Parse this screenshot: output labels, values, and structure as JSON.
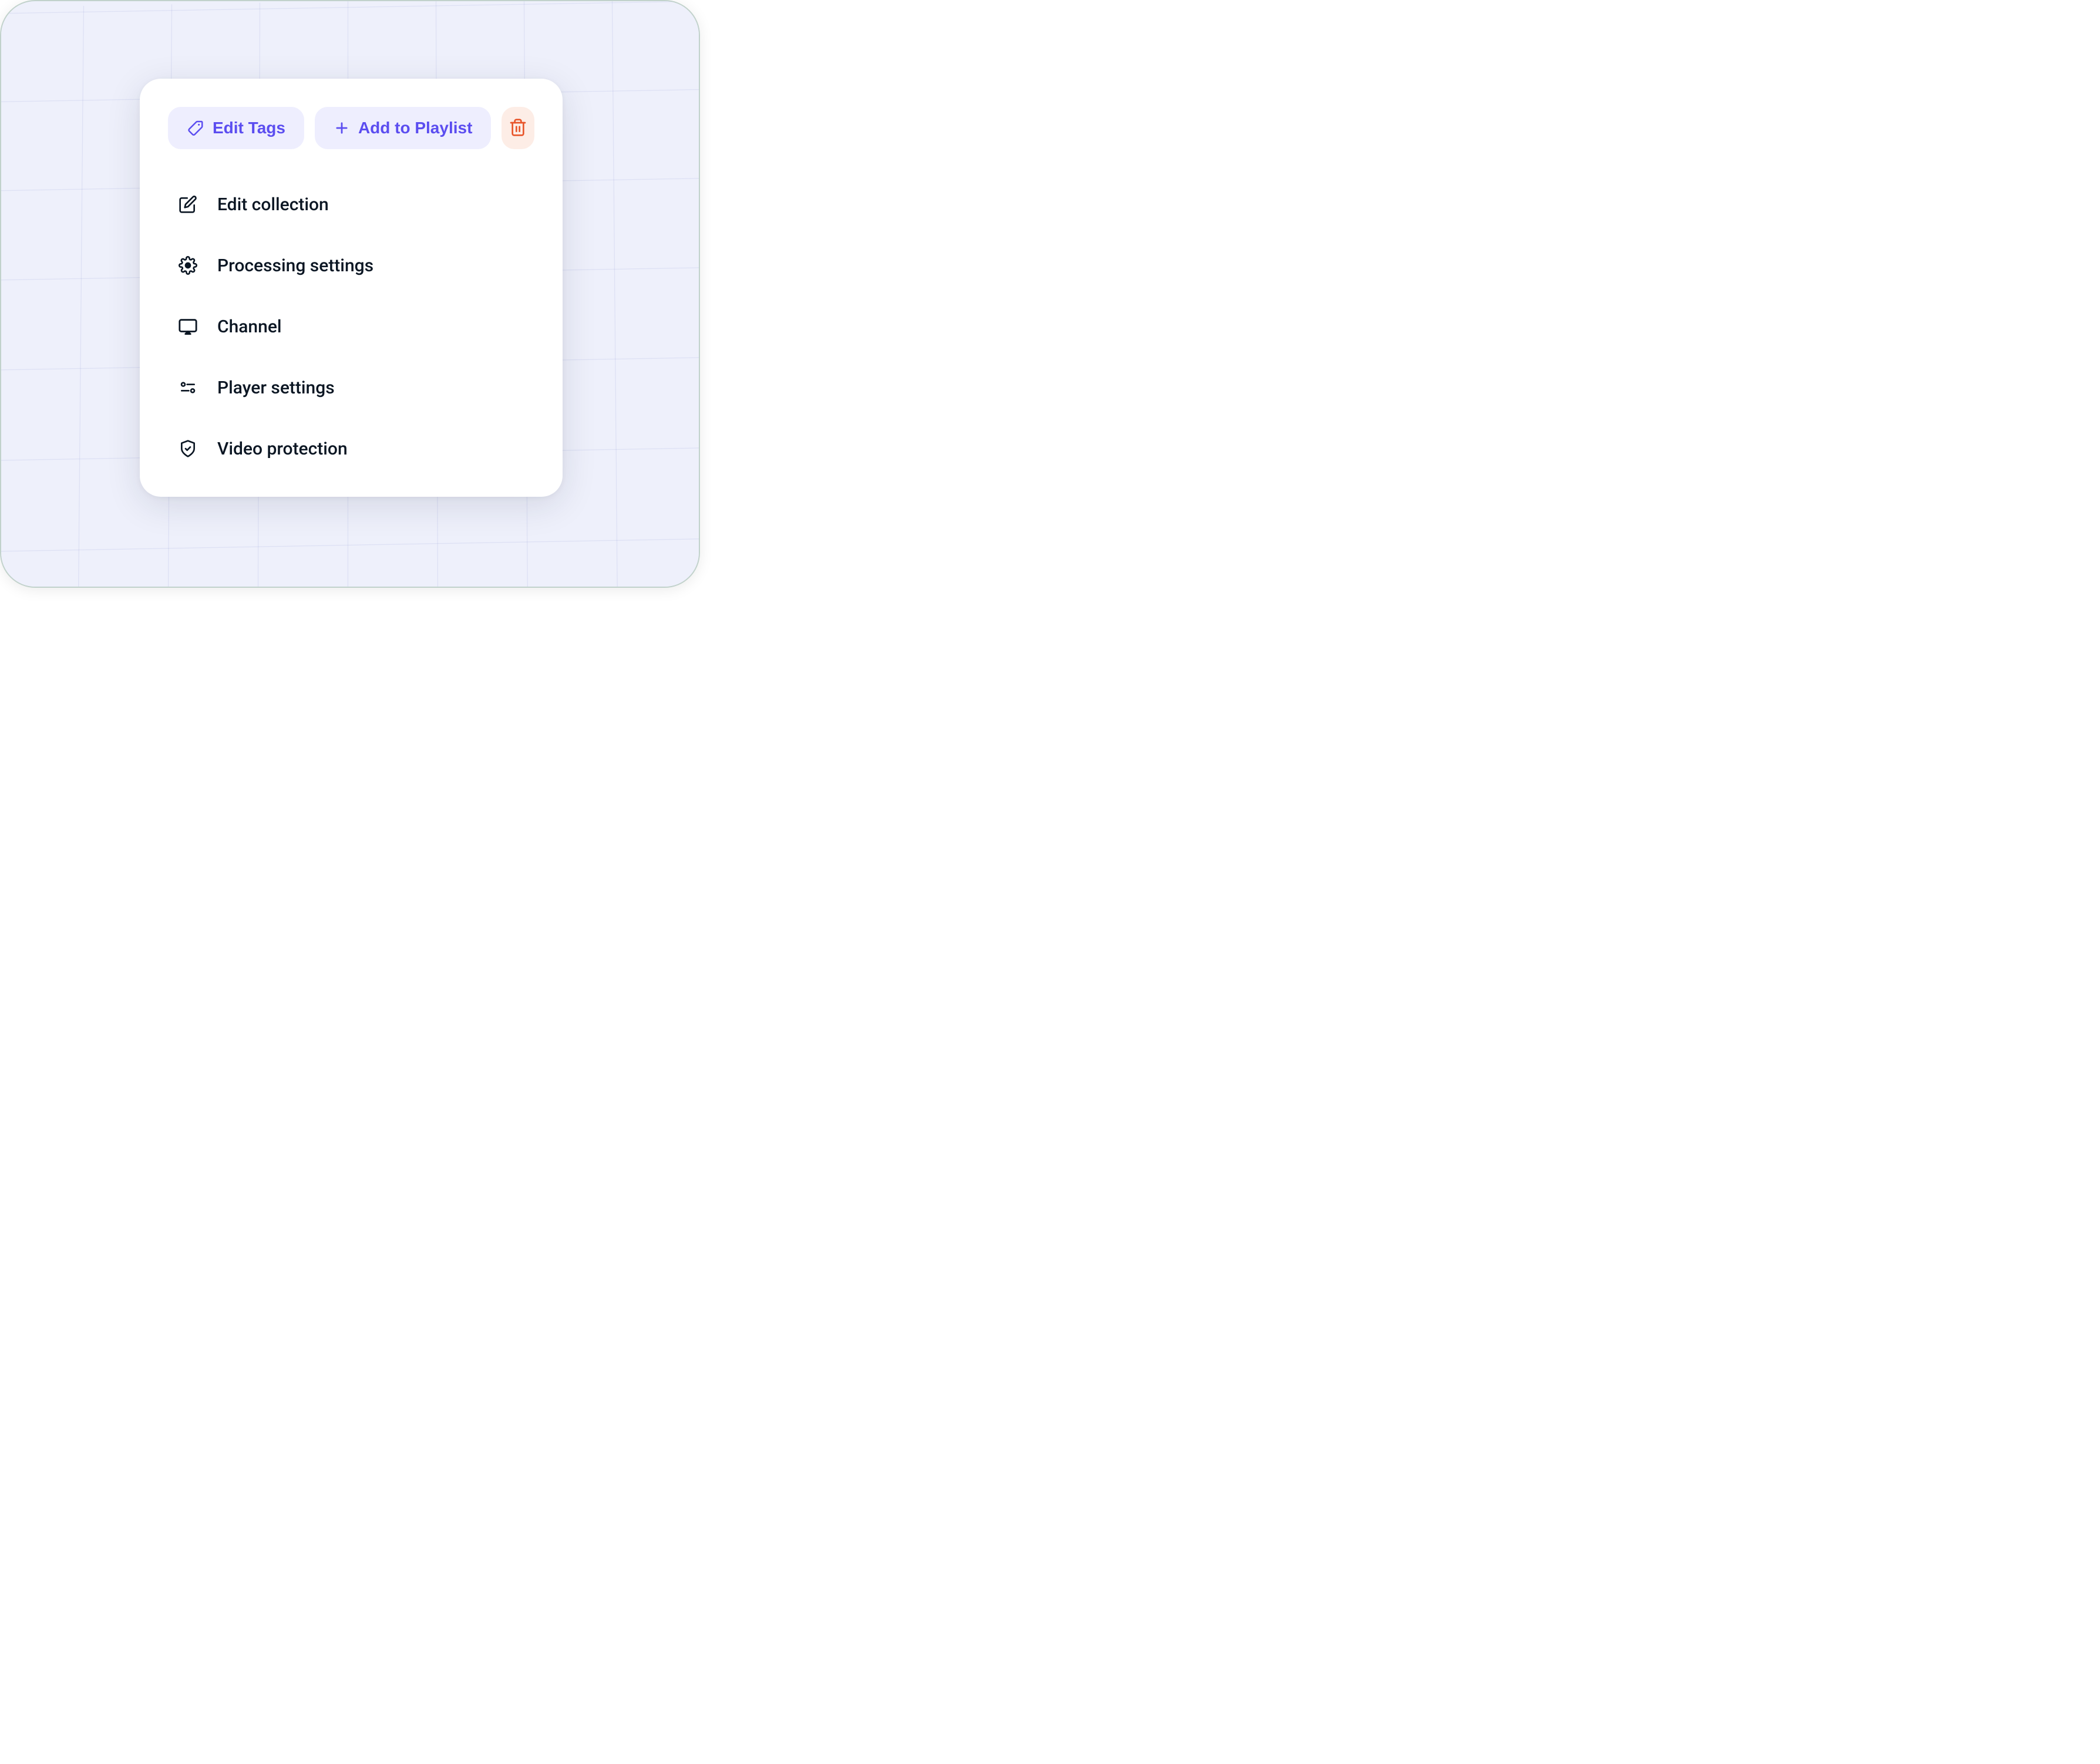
{
  "toolbar": {
    "edit_tags_label": "Edit Tags",
    "add_playlist_label": "Add to Playlist"
  },
  "menu": {
    "items": [
      {
        "label": "Edit collection"
      },
      {
        "label": "Processing settings"
      },
      {
        "label": "Channel"
      },
      {
        "label": "Player settings"
      },
      {
        "label": "Video protection"
      }
    ]
  },
  "colors": {
    "accent": "#5B4DF0",
    "accent_bg": "#EEEEFE",
    "danger": "#E8552A",
    "danger_bg": "#FDEDE6",
    "text": "#0B1623",
    "frame_bg": "#EEF0FB"
  }
}
